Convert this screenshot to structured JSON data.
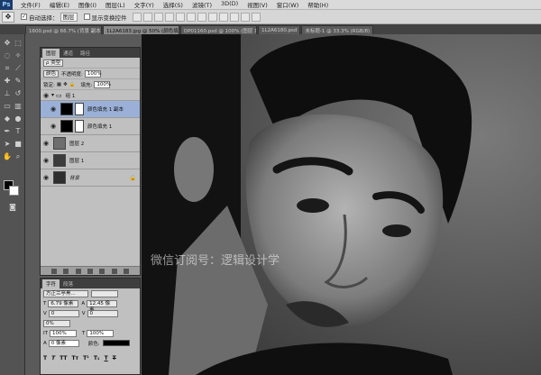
{
  "app": {
    "logo": "Ps"
  },
  "menubar": {
    "items": [
      "文件(F)",
      "编辑(E)",
      "图像(I)",
      "图层(L)",
      "文字(Y)",
      "选择(S)",
      "滤镜(T)",
      "3D(D)",
      "视图(V)",
      "窗口(W)",
      "帮助(H)"
    ]
  },
  "options": {
    "auto_select_label": "自动选择：",
    "auto_select_value": "图层",
    "show_transform_label": "显示变换控件"
  },
  "doc_tabs": [
    {
      "label": "1600.psd @ 66.7% (背景 副本, RGB/8)",
      "active": false
    },
    {
      "label": "1L2A6183.jpg @ 50% (颜色填充 1 副本, RGB/8)",
      "active": true
    },
    {
      "label": "DP01160.psd @ 100% (图层 1 副本, RGB/8)",
      "active": false
    },
    {
      "label": "1L2A6180.psd",
      "active": false
    },
    {
      "label": "未标题-1 @ 33.3% (RGB/8)",
      "active": false
    }
  ],
  "layers_panel": {
    "tabs": [
      "图层",
      "通道",
      "路径"
    ],
    "filter_label": "ρ 类型",
    "blend_mode": "颜色",
    "opacity_label": "不透明度:",
    "opacity_value": "100%",
    "lock_label": "锁定:",
    "fill_label": "填充:",
    "fill_value": "100%",
    "group_name": "组 1",
    "layers": [
      {
        "name": "颜色填充 1 副本",
        "selected": true,
        "thumb_color": "#000000",
        "has_mask": true
      },
      {
        "name": "颜色填充 1",
        "selected": false,
        "thumb_color": "#000000",
        "has_mask": true
      },
      {
        "name": "图层 2",
        "selected": false,
        "thumb_color": "#6e6e6e",
        "has_mask": false
      },
      {
        "name": "图层 1",
        "selected": false,
        "thumb_color": "#3c3c3c",
        "has_mask": false
      },
      {
        "name": "背景",
        "selected": false,
        "thumb_color": "#2e2e2e",
        "has_mask": false
      }
    ]
  },
  "char_panel": {
    "tabs": [
      "字符",
      "段落"
    ],
    "font_family": "方正兰亭黑...",
    "font_size": "6.79 像素",
    "leading": "12.45 像素",
    "kerning": "0",
    "tracking": "0",
    "scale_v": "100%",
    "scale_h": "100%",
    "baseline": "0 像素",
    "color_label": "颜色:",
    "baseline_pct": "0%"
  },
  "canvas": {
    "watermark": "微信订阅号：逻辑设计学"
  }
}
